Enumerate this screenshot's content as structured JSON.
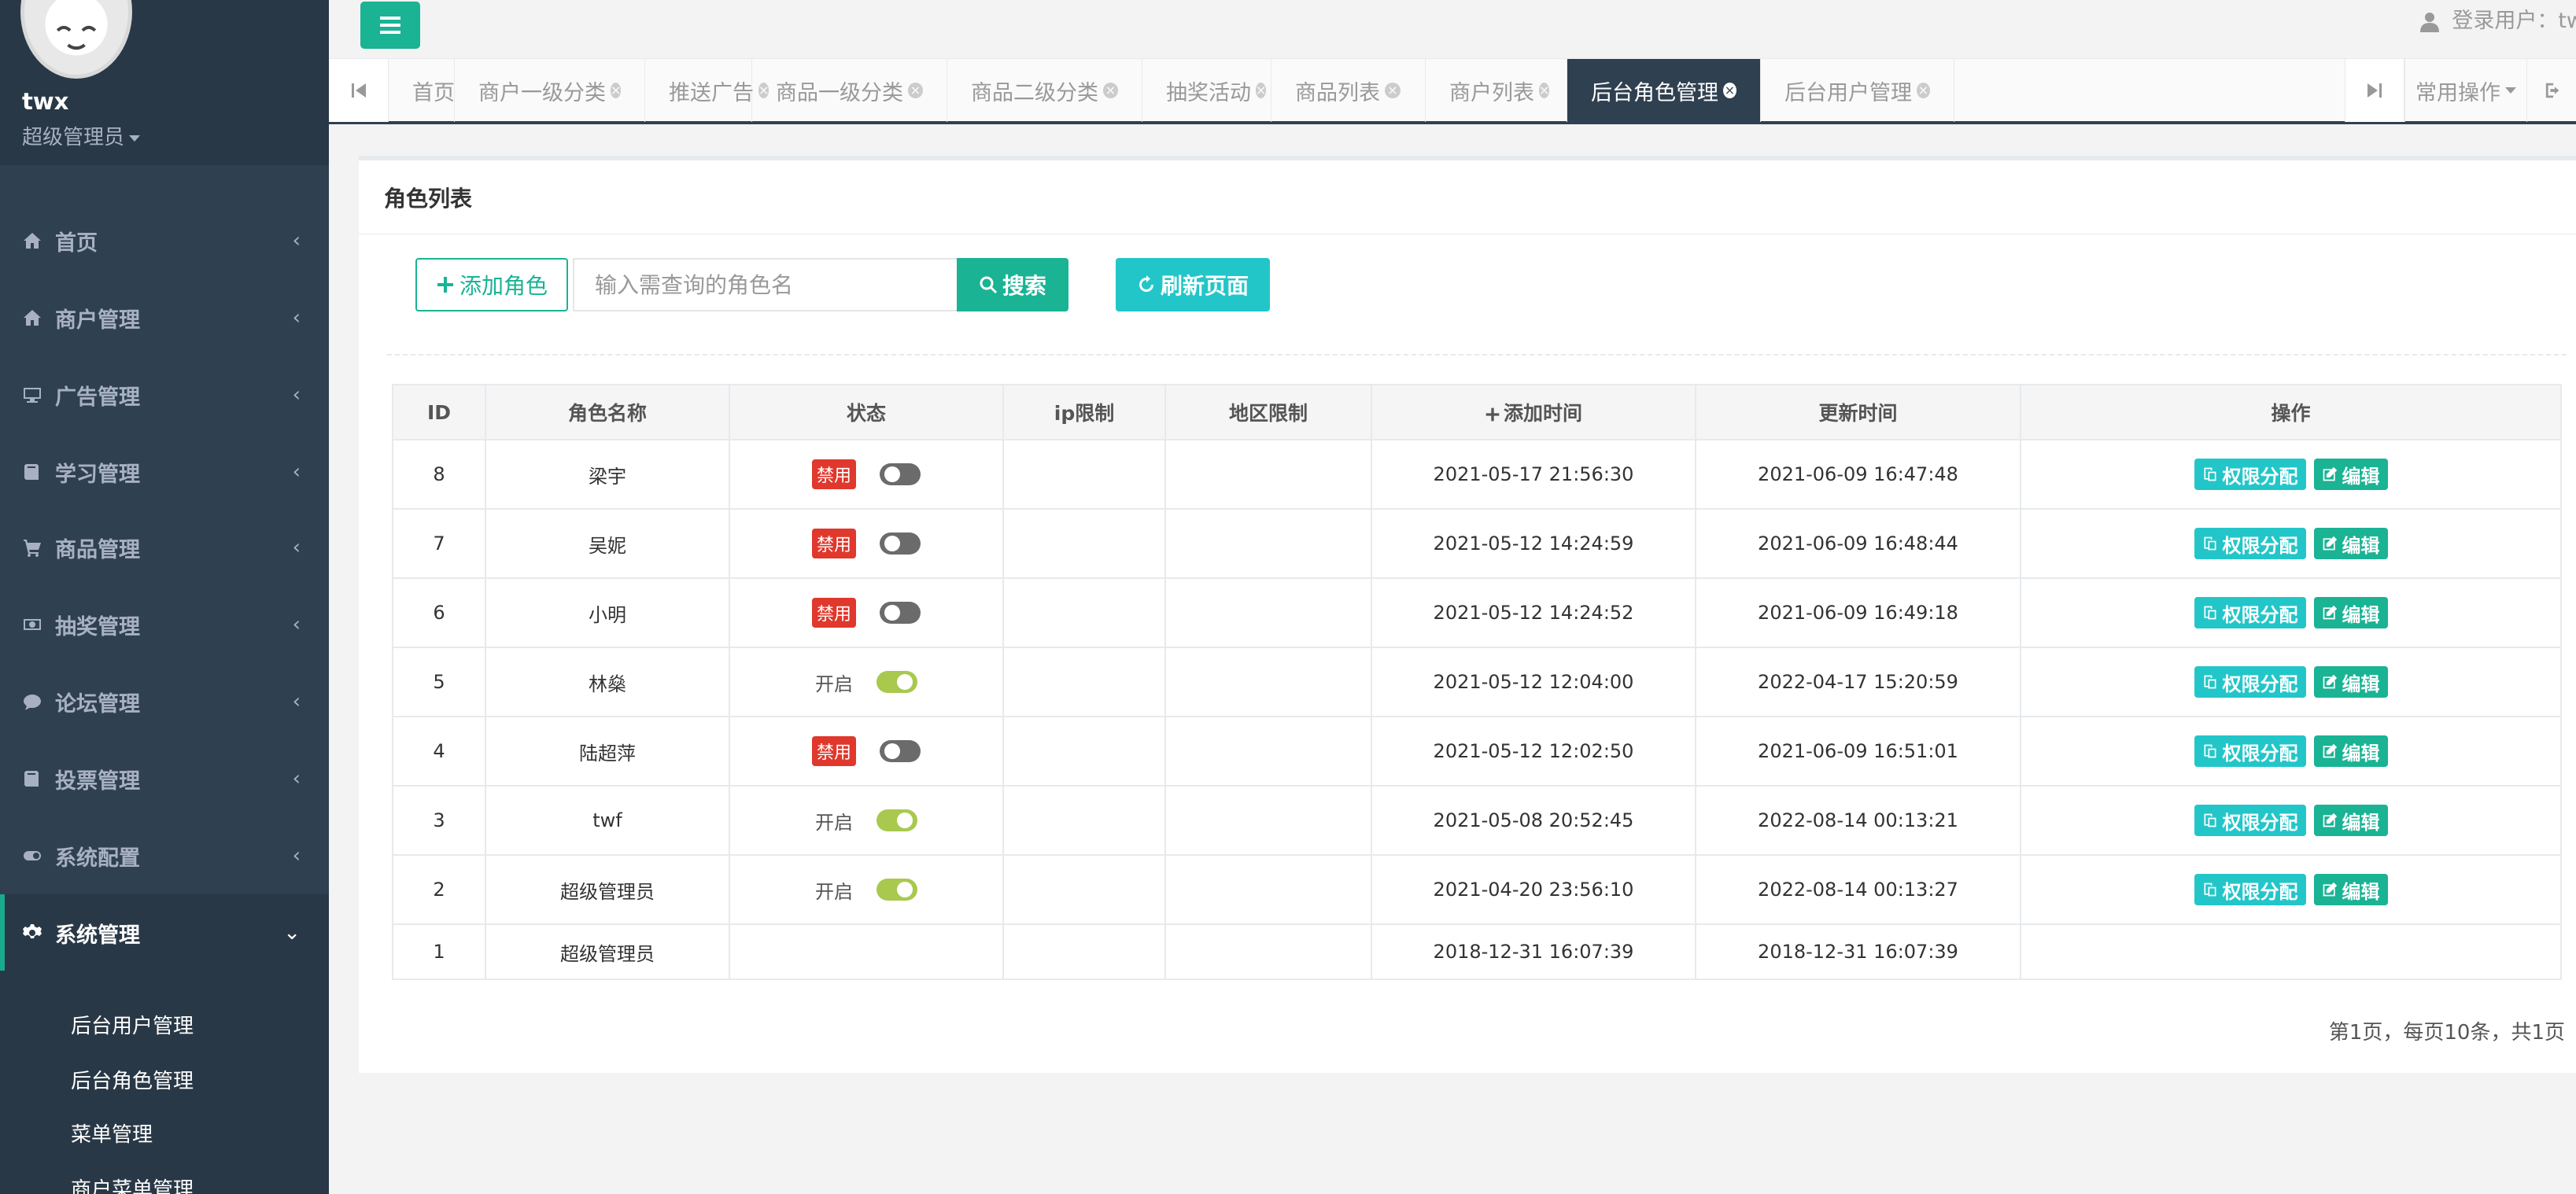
{
  "sidebar": {
    "username": "twx",
    "role": "超级管理员",
    "items": [
      {
        "label": "首页",
        "icon": "home-icon"
      },
      {
        "label": "商户管理",
        "icon": "home-icon"
      },
      {
        "label": "广告管理",
        "icon": "desktop-icon"
      },
      {
        "label": "学习管理",
        "icon": "book-icon"
      },
      {
        "label": "商品管理",
        "icon": "cart-icon"
      },
      {
        "label": "抽奖管理",
        "icon": "money-icon"
      },
      {
        "label": "论坛管理",
        "icon": "comment-icon"
      },
      {
        "label": "投票管理",
        "icon": "book-icon"
      },
      {
        "label": "系统配置",
        "icon": "toggle-icon"
      },
      {
        "label": "系统管理",
        "icon": "gear-icon"
      }
    ],
    "submenu": [
      "后台用户管理",
      "后台角色管理",
      "菜单管理",
      "商户菜单管理"
    ]
  },
  "topbar": {
    "login_label": "登录用户：tw"
  },
  "tabs": [
    "首页",
    "商户一级分类",
    "推送广告",
    "商品一级分类",
    "商品二级分类",
    "抽奖活动",
    "商品列表",
    "商户列表",
    "后台角色管理",
    "后台用户管理"
  ],
  "tabbar": {
    "common_ops": "常用操作",
    "active_tab": "后台角色管理"
  },
  "content": {
    "title": "角色列表",
    "add_button": "添加角色",
    "search_placeholder": "输入需查询的角色名",
    "search_button": "搜索",
    "refresh_button": "刷新页面"
  },
  "table": {
    "headers": [
      "ID",
      "角色名称",
      "状态",
      "ip限制",
      "地区限制",
      "添加时间",
      "更新时间",
      "操作"
    ],
    "rows": [
      {
        "id": "8",
        "name": "梁宇",
        "status": "禁用",
        "enabled": false,
        "added": "2021-05-17 21:56:30",
        "updated": "2021-06-09 16:47:48"
      },
      {
        "id": "7",
        "name": "吴妮",
        "status": "禁用",
        "enabled": false,
        "added": "2021-05-12 14:24:59",
        "updated": "2021-06-09 16:48:44"
      },
      {
        "id": "6",
        "name": "小明",
        "status": "禁用",
        "enabled": false,
        "added": "2021-05-12 14:24:52",
        "updated": "2021-06-09 16:49:18"
      },
      {
        "id": "5",
        "name": "林燊",
        "status": "开启",
        "enabled": true,
        "added": "2021-05-12 12:04:00",
        "updated": "2022-04-17 15:20:59"
      },
      {
        "id": "4",
        "name": "陆超萍",
        "status": "禁用",
        "enabled": false,
        "added": "2021-05-12 12:02:50",
        "updated": "2021-06-09 16:51:01"
      },
      {
        "id": "3",
        "name": "twf",
        "status": "开启",
        "enabled": true,
        "added": "2021-05-08 20:52:45",
        "updated": "2022-08-14 00:13:21"
      },
      {
        "id": "2",
        "name": "超级管理员",
        "status": "开启",
        "enabled": true,
        "added": "2021-04-20 23:56:10",
        "updated": "2022-08-14 00:13:27"
      },
      {
        "id": "1",
        "name": "超级管理员",
        "status": "",
        "enabled": null,
        "added": "2018-12-31 16:07:39",
        "updated": "2018-12-31 16:07:39"
      }
    ],
    "op_assign": "权限分配",
    "op_edit": "编辑"
  },
  "pagination": "第1页，每页10条，共1页",
  "colors": {
    "sidebar_bg": "#2f4050",
    "primary": "#1ab394",
    "info": "#23c6c8",
    "danger": "#e0382c",
    "switch_on": "#a8c94d"
  }
}
